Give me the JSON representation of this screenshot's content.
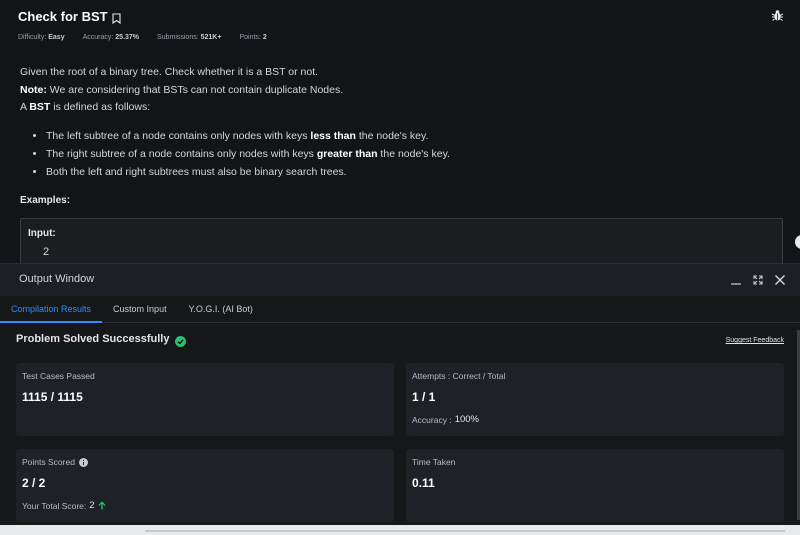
{
  "problem": {
    "title": "Check for BST",
    "meta": [
      {
        "label": "Difficulty:",
        "value": "Easy"
      },
      {
        "label": "Accuracy:",
        "value": "25.37%"
      },
      {
        "label": "Submissions:",
        "value": "521K+"
      },
      {
        "label": "Points:",
        "value": "2"
      }
    ],
    "line1": "Given the root of a binary tree. Check whether it is a BST or not.",
    "note_label": "Note:",
    "note_text": " We are considering that BSTs can not contain duplicate Nodes.",
    "line3_pre": "A ",
    "line3_bold": "BST",
    "line3_post": " is defined as follows:",
    "bullets": [
      {
        "pre": "The left subtree of a node contains only nodes with keys ",
        "bold": "less than",
        "post": " the node's key."
      },
      {
        "pre": "The right subtree of a node contains only nodes with keys ",
        "bold": "greater than",
        "post": " the node's key."
      },
      {
        "pre": "Both the left and right subtrees must also be binary search trees.",
        "bold": "",
        "post": ""
      }
    ],
    "examples_label": "Examples:",
    "example": {
      "input_label": "Input:",
      "input_value": "2"
    }
  },
  "output": {
    "window_title": "Output Window",
    "tabs": [
      {
        "label": "Compilation Results",
        "active": true
      },
      {
        "label": "Custom Input",
        "active": false
      },
      {
        "label": "Y.O.G.I. (AI Bot)",
        "active": false
      }
    ],
    "status": "Problem Solved Successfully",
    "feedback_link": "Suggest Feedback",
    "cards": {
      "test_cases": {
        "label": "Test Cases Passed",
        "value": "1115 / 1115"
      },
      "attempts": {
        "label": "Attempts : Correct / Total",
        "value": "1 / 1",
        "sub_label": "Accuracy : ",
        "sub_value": "100%"
      },
      "points": {
        "label": "Points Scored",
        "value": "2 / 2",
        "sub_label": "Your Total Score: ",
        "sub_value": "2"
      },
      "time": {
        "label": "Time Taken",
        "value": "0.11"
      }
    }
  },
  "colors": {
    "accent": "#2f8cff",
    "success": "#2fbf71",
    "background": "#121417"
  },
  "icons": [
    "bookmark-icon",
    "bug-icon",
    "minimize-icon",
    "expand-icon",
    "close-icon",
    "check-circle-icon",
    "info-icon",
    "arrow-up-icon"
  ]
}
